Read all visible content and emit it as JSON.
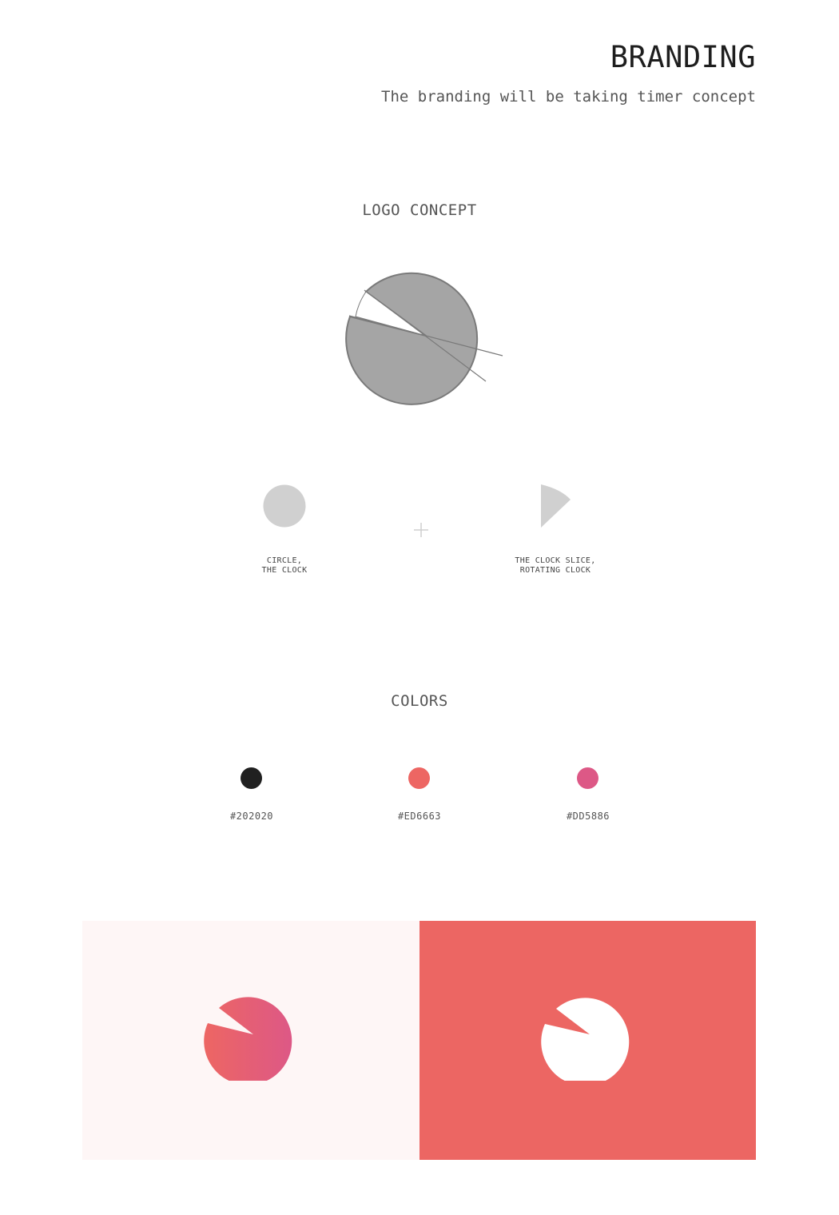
{
  "header": {
    "title": "BRANDING",
    "subtitle": "The branding will be taking timer concept"
  },
  "logo_concept": {
    "heading": "LOGO CONCEPT",
    "parts": [
      {
        "icon": "circle-shape-icon",
        "caption_line1": "CIRCLE,",
        "caption_line2": "THE CLOCK"
      },
      {
        "icon": "clock-slice-icon",
        "caption_line1": "THE CLOCK SLICE,",
        "caption_line2": "ROTATING CLOCK"
      }
    ],
    "combine_icon": "plus-icon"
  },
  "colors": {
    "heading": "COLORS",
    "swatches": [
      {
        "hex": "#202020",
        "label": "#202020"
      },
      {
        "hex": "#ED6663",
        "label": "#ED6663"
      },
      {
        "hex": "#DD5886",
        "label": "#DD5886"
      }
    ]
  },
  "mockups": {
    "light_background": "#FEF6F6",
    "dark_background": "#EC6663",
    "logo_on_light": "gradient-logo-icon",
    "logo_on_dark": "white-logo-icon"
  }
}
